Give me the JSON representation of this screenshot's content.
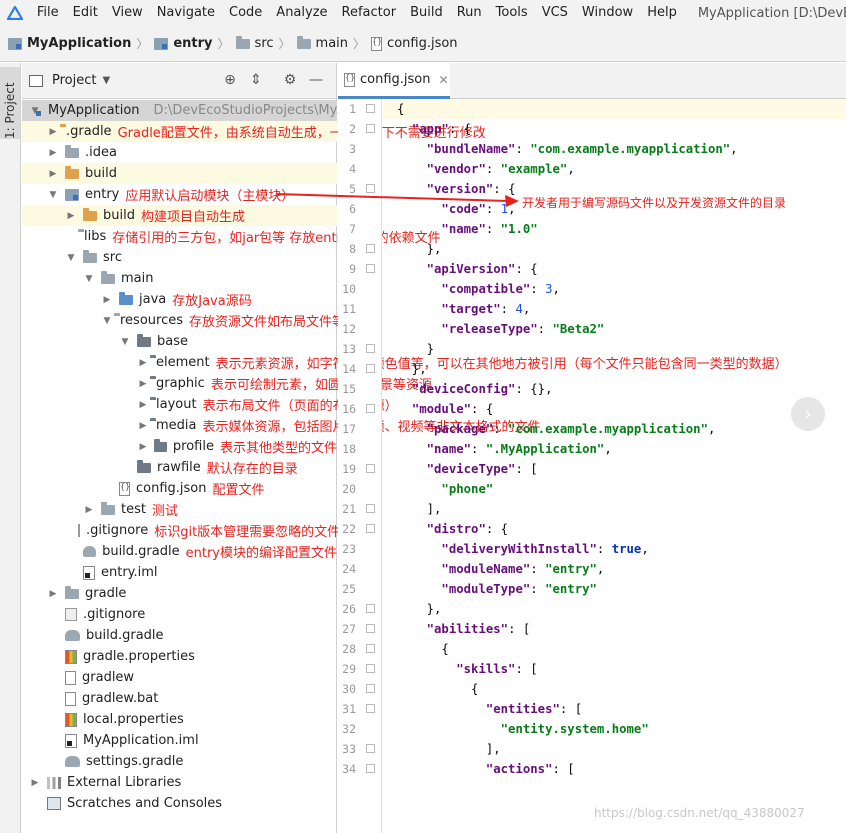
{
  "menubar": {
    "items": [
      "File",
      "Edit",
      "View",
      "Navigate",
      "Code",
      "Analyze",
      "Refactor",
      "Build",
      "Run",
      "Tools",
      "VCS",
      "Window",
      "Help"
    ],
    "window_title": "MyApplication [D:\\DevEco"
  },
  "breadcrumb": [
    "MyApplication",
    "entry",
    "src",
    "main",
    "config.json"
  ],
  "project_panel": {
    "title": "Project"
  },
  "left_strip": {
    "label": "1: Project"
  },
  "tree": [
    {
      "label": "MyApplication",
      "path": "D:\\DevEcoStudioProjects\\MyAp",
      "note": "",
      "icon": "module-icon",
      "level": 0,
      "arrow": "▼",
      "state": "selected"
    },
    {
      "label": ".gradle",
      "note": "Gradle配置文件，由系统自动生成，一般情况下不需要进行修改",
      "icon": "folder-orange-icon",
      "level": 1,
      "arrow": "▶",
      "state": "highlighted"
    },
    {
      "label": ".idea",
      "note": "",
      "icon": "folder-icon",
      "level": 1,
      "arrow": "▶",
      "state": ""
    },
    {
      "label": "build",
      "note": "",
      "icon": "folder-orange-icon",
      "level": 1,
      "arrow": "▶",
      "state": "highlighted"
    },
    {
      "label": "entry",
      "note": "应用默认启动模块（主模块）",
      "icon": "module-icon",
      "level": 1,
      "arrow": "▼",
      "state": ""
    },
    {
      "label": "build",
      "note": "构建项目自动生成",
      "icon": "folder-orange-icon",
      "level": 2,
      "arrow": "▶",
      "state": "highlighted"
    },
    {
      "label": "libs",
      "note": "存储引用的三方包，如jar包等  存放entry模块的依赖文件",
      "icon": "folder-icon",
      "level": 2,
      "arrow": "",
      "state": ""
    },
    {
      "label": "src",
      "note": "",
      "icon": "folder-icon",
      "level": 2,
      "arrow": "▼",
      "state": ""
    },
    {
      "label": "main",
      "note": "",
      "icon": "folder-icon",
      "level": 3,
      "arrow": "▼",
      "state": ""
    },
    {
      "label": "java",
      "note": "存放Java源码",
      "icon": "folder-blue-icon",
      "level": 4,
      "arrow": "▶",
      "state": ""
    },
    {
      "label": "resources",
      "note": "存放资源文件如布局文件等",
      "icon": "resources-folder-icon",
      "level": 4,
      "arrow": "▼",
      "state": ""
    },
    {
      "label": "base",
      "note": "",
      "icon": "folder-dark-icon",
      "level": 5,
      "arrow": "▼",
      "state": ""
    },
    {
      "label": "element",
      "note": "表示元素资源，如字符串、颜色值等，可以在其他地方被引用（每个文件只能包含同一类型的数据）",
      "icon": "folder-dark-icon",
      "level": 6,
      "arrow": "▶",
      "state": ""
    },
    {
      "label": "graphic",
      "note": "表示可绘制元素，如圆角、背景等资源",
      "icon": "folder-dark-icon",
      "level": 6,
      "arrow": "▶",
      "state": ""
    },
    {
      "label": "layout",
      "note": "表示布局文件（页面的布局资源）",
      "icon": "folder-dark-icon",
      "level": 6,
      "arrow": "▶",
      "state": ""
    },
    {
      "label": "media",
      "note": "表示媒体资源，包括图片、音频、视频等非文本格式的文件",
      "icon": "folder-dark-icon",
      "level": 6,
      "arrow": "▶",
      "state": ""
    },
    {
      "label": "profile",
      "note": "表示其他类型的文件",
      "icon": "folder-dark-icon",
      "level": 6,
      "arrow": "▶",
      "state": ""
    },
    {
      "label": "rawfile",
      "note": "默认存在的目录",
      "icon": "folder-dark-icon",
      "level": 5,
      "arrow": "",
      "state": ""
    },
    {
      "label": "config.json",
      "note": "配置文件",
      "icon": "json-file-icon",
      "level": 4,
      "arrow": "",
      "state": ""
    },
    {
      "label": "test",
      "note": "测试",
      "icon": "folder-icon",
      "level": 3,
      "arrow": "▶",
      "state": ""
    },
    {
      "label": ".gitignore",
      "note": "标识git版本管理需要忽略的文件",
      "icon": "gitignore-icon",
      "level": 2,
      "arrow": "",
      "state": ""
    },
    {
      "label": "build.gradle",
      "note": "entry模块的编译配置文件",
      "icon": "gradle-icon",
      "level": 2,
      "arrow": "",
      "state": ""
    },
    {
      "label": "entry.iml",
      "note": "",
      "icon": "iml-file-icon",
      "level": 2,
      "arrow": "",
      "state": ""
    },
    {
      "label": "gradle",
      "note": "",
      "icon": "folder-icon",
      "level": 1,
      "arrow": "▶",
      "state": ""
    },
    {
      "label": ".gitignore",
      "note": "",
      "icon": "gitignore-icon",
      "level": 1,
      "arrow": "",
      "state": ""
    },
    {
      "label": "build.gradle",
      "note": "",
      "icon": "gradle-icon",
      "level": 1,
      "arrow": "",
      "state": ""
    },
    {
      "label": "gradle.properties",
      "note": "",
      "icon": "properties-icon",
      "level": 1,
      "arrow": "",
      "state": ""
    },
    {
      "label": "gradlew",
      "note": "",
      "icon": "file-icon",
      "level": 1,
      "arrow": "",
      "state": ""
    },
    {
      "label": "gradlew.bat",
      "note": "",
      "icon": "file-icon",
      "level": 1,
      "arrow": "",
      "state": ""
    },
    {
      "label": "local.properties",
      "note": "",
      "icon": "properties-icon",
      "level": 1,
      "arrow": "",
      "state": ""
    },
    {
      "label": "MyApplication.iml",
      "note": "",
      "icon": "iml-file-icon",
      "level": 1,
      "arrow": "",
      "state": ""
    },
    {
      "label": "settings.gradle",
      "note": "",
      "icon": "gradle-icon",
      "level": 1,
      "arrow": "",
      "state": ""
    },
    {
      "label": "External Libraries",
      "note": "",
      "icon": "libraries-icon",
      "level": 0,
      "arrow": "▶",
      "state": ""
    },
    {
      "label": "Scratches and Consoles",
      "note": "",
      "icon": "console-icon",
      "level": 0,
      "arrow": "",
      "state": ""
    }
  ],
  "editor": {
    "tab_label": "config.json",
    "lines": [
      "{",
      "  \"app\": {",
      "    \"bundleName\": \"com.example.myapplication\",",
      "    \"vendor\": \"example\",",
      "    \"version\": {",
      "      \"code\": 1,",
      "      \"name\": \"1.0\"",
      "    },",
      "    \"apiVersion\": {",
      "      \"compatible\": 3,",
      "      \"target\": 4,",
      "      \"releaseType\": \"Beta2\"",
      "    }",
      "  },",
      "  \"deviceConfig\": {},",
      "  \"module\": {",
      "    \"package\": \"com.example.myapplication\",",
      "    \"name\": \".MyApplication\",",
      "    \"deviceType\": [",
      "      \"phone\"",
      "    ],",
      "    \"distro\": {",
      "      \"deliveryWithInstall\": true,",
      "      \"moduleName\": \"entry\",",
      "      \"moduleType\": \"entry\"",
      "    },",
      "    \"abilities\": [",
      "      {",
      "        \"skills\": [",
      "          {",
      "            \"entities\": [",
      "              \"entity.system.home\"",
      "            ],",
      "            \"actions\": ["
    ]
  },
  "annotations": {
    "src_note": "开发者用于编写源码文件以及开发资源文件的目录"
  },
  "watermark": "https://blog.csdn.net/qq_43880027"
}
